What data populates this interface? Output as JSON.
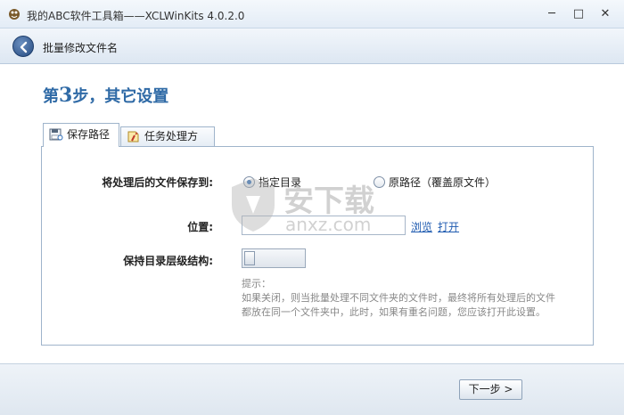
{
  "window": {
    "title": "我的ABC软件工具箱——XCLWinKits  4.0.2.0",
    "minimize": "─",
    "maximize": "□",
    "close": "✕"
  },
  "nav": {
    "title": "批量修改文件名"
  },
  "step": {
    "prefix": "第",
    "number": "3",
    "suffix": "步，其它设置"
  },
  "tabs": [
    {
      "label": "保存路径",
      "icon": "save-path-icon",
      "active": true
    },
    {
      "label": "任务处理方式",
      "icon": "task-icon",
      "active": false
    }
  ],
  "form": {
    "save_to_label": "将处理后的文件保存到:",
    "radio_specified": "指定目录",
    "radio_original": "原路径（覆盖原文件）",
    "location_label": "位置:",
    "location_value": "",
    "browse_link": "浏览",
    "open_link": "打开",
    "keep_structure_label": "保持目录层级结构:",
    "hint_title": "提示：",
    "hint_line1": "如果关闭，则当批量处理不同文件夹的文件时，最终将所有处理后的文件",
    "hint_line2": "都放在同一个文件夹中，此时，如果有重名问题，您应该打开此设置。"
  },
  "watermark": {
    "cn": "安下载",
    "en": "anxz.com"
  },
  "footer": {
    "next_label": "下一步 >"
  },
  "colors": {
    "accent": "#2f6aa6",
    "link": "#1f5bb0"
  }
}
